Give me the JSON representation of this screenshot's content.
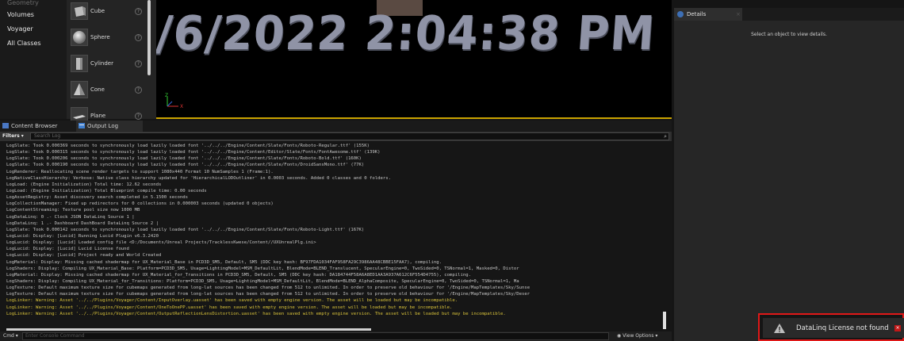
{
  "placement": {
    "categories": [
      "Geometry",
      "Volumes",
      "Voyager",
      "All Classes"
    ],
    "items": [
      {
        "label": "Cube",
        "icon": "cube-icon"
      },
      {
        "label": "Sphere",
        "icon": "sphere-icon"
      },
      {
        "label": "Cylinder",
        "icon": "cylinder-icon"
      },
      {
        "label": "Cone",
        "icon": "cone-icon"
      },
      {
        "label": "Plane",
        "icon": "plane-icon"
      }
    ],
    "info_glyph": "?"
  },
  "viewport": {
    "clock_text": "/6/2022 2:04:38 PM",
    "gizmo_x": "X",
    "gizmo_z": "Z"
  },
  "details": {
    "tab_label": "Details",
    "tab_close": "×",
    "empty_message": "Select an object to view details."
  },
  "bottom_tabs": {
    "content_browser": "Content Browser",
    "output_log": "Output Log"
  },
  "filters": {
    "label": "Filters ▾",
    "search_placeholder": "Search Log",
    "search_icon": "⌕"
  },
  "log_lines": [
    {
      "text": "LogSlate: Took 0.000369 seconds to synchronously load lazily loaded font '../../../Engine/Content/Slate/Fonts/Roboto-Regular.ttf' (155K)",
      "level": "normal"
    },
    {
      "text": "LogSlate: Took 0.000315 seconds to synchronously load lazily loaded font '../../../Engine/Content/Editor/Slate/Fonts/FontAwesome.ttf' (139K)",
      "level": "normal"
    },
    {
      "text": "LogSlate: Took 0.000206 seconds to synchronously load lazily loaded font '../../../Engine/Content/Slate/Fonts/Roboto-Bold.ttf' (160K)",
      "level": "normal"
    },
    {
      "text": "LogSlate: Took 0.000190 seconds to synchronously load lazily loaded font '../../../Engine/Content/Slate/Fonts/DroidSansMono.ttf' (77K)",
      "level": "normal"
    },
    {
      "text": "LogRenderer: Reallocating scene render targets to support 1080x440 Format 10 NumSamples 1 (Frame:1).",
      "level": "normal"
    },
    {
      "text": "LogNativeClassHierarchy: Verbose: Native class hierarchy updated for 'HierarchicalLODOutliner' in 0.0003 seconds. Added 0 classes and 0 folders.",
      "level": "normal"
    },
    {
      "text": "LogLoad: (Engine Initialization) Total time: 12.62 seconds",
      "level": "normal"
    },
    {
      "text": "LogLoad: (Engine Initialization) Total Blueprint compile time: 0.00 seconds",
      "level": "normal"
    },
    {
      "text": "LogAssetRegistry: Asset discovery search completed in 5.1500 seconds",
      "level": "normal"
    },
    {
      "text": "LogCollectionManager: Fixed up redirectors for 0 collections in 0.000003 seconds (updated 0 objects)",
      "level": "normal"
    },
    {
      "text": "LogContentStreaming: Texture pool size now 1000 MB",
      "level": "normal"
    },
    {
      "text": "LogDataLinq: 0 .- Clock JSON DataLinq Source 1 |",
      "level": "normal"
    },
    {
      "text": "LogDataLinq: 1 .- Dashboard DashBoard DataLinq Source 2 |",
      "level": "normal"
    },
    {
      "text": "LogSlate: Took 0.000142 seconds to synchronously load lazily loaded font '../../../Engine/Content/Slate/Fonts/Roboto-Light.ttf' (167K)",
      "level": "normal"
    },
    {
      "text": "LogLucid: Display: [Lucid] Running Lucid Plugin v6.3.2420",
      "level": "normal"
    },
    {
      "text": "LogLucid: Display: [Lucid] Loaded config file <D:/Documents/Unreal Projects/TracklessKwese/Content//UXUnrealPlg.ini>",
      "level": "normal"
    },
    {
      "text": "LogLucid: Display: [Lucid] Lucid License found",
      "level": "normal"
    },
    {
      "text": "LogLucid: Display: [Lucid] Project ready and World Created",
      "level": "normal"
    },
    {
      "text": "LogMaterial: Display: Missing cached shadermap for UX_Material_Base in PCD3D_SM5, Default, SM5 (DDC key hash: BF97FDA1034FAF958FA29C3986AA48CBBE15FAA7), compiling.",
      "level": "normal"
    },
    {
      "text": "LogShaders: Display:    Compiling UX_Material_Base: Platform=PCD3D_SM5, Usage=LightingModel=MSM_DefaultLit, BlendMode=BLEND_Translucent, SpecularEngine=0, TwoSided=0, TSNormal=1, Masked=0, Distor",
      "level": "normal"
    },
    {
      "text": "LogMaterial: Display: Missing cached shadermap for UX_Material_for_Transitions in PCD3D_SM5, Default, SM5 (DDC key hash: DA184744F58A6A8ED1AA3A937A612C6F554D4755), compiling.",
      "level": "normal"
    },
    {
      "text": "LogShaders: Display:    Compiling UX_Material_for_Transitions: Platform=PCD3D_SM5, Usage=LightingModel=MSM_DefaultLit, BlendMode=BLEND_AlphaComposite, SpecularEngine=0, TwoSided=0, TSNormal=1, Ma",
      "level": "normal"
    },
    {
      "text": "LogTexture: Default maximum texture size for cubemaps generated from long-lat sources has been changed from 512 to unlimited. In order to preserve old behaviour for '/Engine/MapTemplates/Sky/Sunse",
      "level": "normal"
    },
    {
      "text": "LogTexture: Default maximum texture size for cubemaps generated from long-lat sources has been changed from 512 to unlimited. In order to preserve old behaviour for '/Engine/MapTemplates/Sky/Deser",
      "level": "normal"
    },
    {
      "text": "LogLinker: Warning: Asset '../../Plugins/Voyager/Content/InputOverlay.uasset' has been saved with empty engine version. The asset will be loaded but may be incompatible.",
      "level": "warn"
    },
    {
      "text": "LogLinker: Warning: Asset '../../Plugins/Voyager/Content/OneToOnePP.uasset' has been saved with empty engine version. The asset will be loaded but may be incompatible.",
      "level": "warn"
    },
    {
      "text": "LogLinker: Warning: Asset '../../Plugins/Voyager/Content/OutputReflectionLensDistortion.uasset' has been saved with empty engine version. The asset will be loaded but may be incompatible.",
      "level": "warn"
    }
  ],
  "command": {
    "label": "Cmd ▾",
    "placeholder": "Enter Console Command",
    "view_options": "◉ View Options ▾"
  },
  "notification": {
    "text": "DataLinq License not found",
    "close": "×",
    "icon": "warning-icon"
  },
  "colors": {
    "accent_yellow": "#caa300",
    "warning_text": "#d8c23a",
    "highlight_red": "#e01818"
  }
}
